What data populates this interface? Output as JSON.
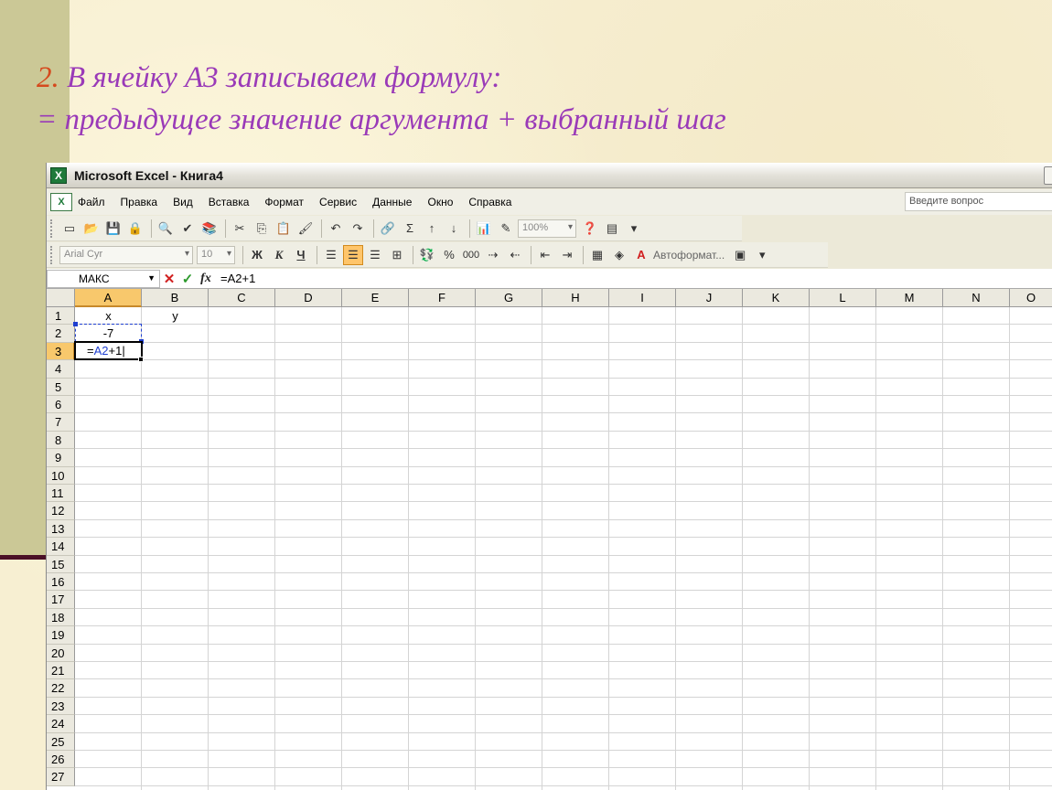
{
  "slide": {
    "title_number": "2.",
    "title_line1": "В ячейку А3 записываем формулу:",
    "title_line2": "= предыдущее значение аргумента + выбранный шаг"
  },
  "window": {
    "title": "Microsoft Excel - Книга4",
    "icon_letter": "X"
  },
  "menu": {
    "items": [
      "Файл",
      "Правка",
      "Вид",
      "Вставка",
      "Формат",
      "Сервис",
      "Данные",
      "Окно",
      "Справка"
    ],
    "help_placeholder": "Введите вопрос"
  },
  "toolbar_standard": {
    "zoom": "100%",
    "sum_symbol": "Σ"
  },
  "toolbar_format": {
    "font": "Arial Cyr",
    "size": "10",
    "bold_label": "Ж",
    "italic_label": "К",
    "underline_label": "Ч",
    "percent_label": "%",
    "thousands_label": "000",
    "autoformat_label": "Автоформат..."
  },
  "formula_bar": {
    "name_box": "МАКС",
    "fx_label": "fx",
    "formula": "=A2+1"
  },
  "sheet": {
    "columns": [
      "A",
      "B",
      "C",
      "D",
      "E",
      "F",
      "G",
      "H",
      "I",
      "J",
      "K",
      "L",
      "M",
      "N",
      "O"
    ],
    "rows": [
      "1",
      "2",
      "3",
      "4",
      "5",
      "6",
      "7",
      "8",
      "9",
      "10",
      "11",
      "12",
      "13",
      "14",
      "15",
      "16",
      "17",
      "18",
      "19",
      "20",
      "21",
      "22",
      "23",
      "24",
      "25",
      "26",
      "27"
    ],
    "cells": {
      "A1": "x",
      "B1": "y",
      "A2": "-7",
      "A3_prefix": "=",
      "A3_ref": "A2",
      "A3_suffix": "+1"
    },
    "active_column": "A",
    "active_row": "3"
  },
  "colors": {
    "title_text": "#9a3ab8",
    "title_number": "#d5491d",
    "slide_band": "#cbc896",
    "reference_blue": "#1f3fd0",
    "header_active": "#f8c86c"
  }
}
